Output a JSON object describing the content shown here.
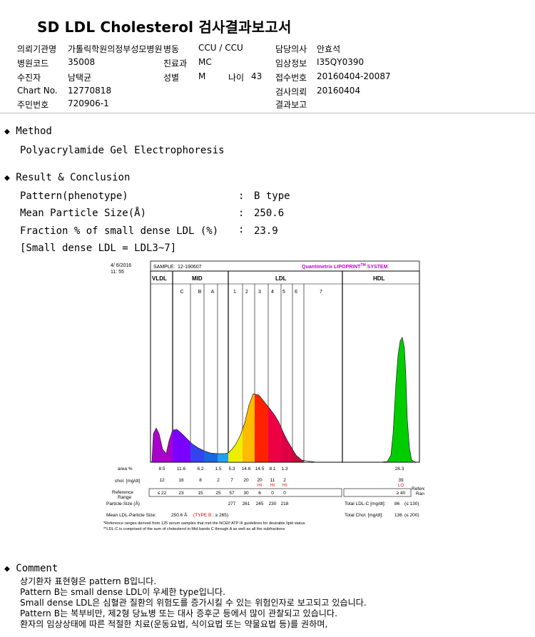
{
  "report_title": "SD LDL Cholesterol 검사결과보고서",
  "patient_info": {
    "institution_label": "의뢰기관명",
    "institution": "가톨릭학원의정부성모병원",
    "ward_label": "병동",
    "ward": "CCU / CCU",
    "doctor_label": "담당의사",
    "doctor": "안효석",
    "hospital_code_label": "병원코드",
    "hospital_code": "35008",
    "dept_label": "진료과",
    "dept": "MC",
    "clinical_label": "임상정보",
    "clinical": "I35QY0390",
    "patient_label": "수진자",
    "patient": "남택균",
    "sex_label": "성별",
    "sex": "M",
    "age_label": "나이",
    "age": "43",
    "receipt_label": "접수번호",
    "receipt": "20160404-20087",
    "chart_label": "Chart No.",
    "chart": "12770818",
    "request_date_label": "검사의뢰",
    "request_date": "20160404",
    "rrn_label": "주민번호",
    "rrn": "720906-1",
    "report_label": "결과보고",
    "report_date": ""
  },
  "method": {
    "heading": "Method",
    "text": "Polyacrylamide Gel Electrophoresis"
  },
  "result": {
    "heading": "Result & Conclusion",
    "rows": [
      {
        "label": "Pattern(phenotype)",
        "value": "B type"
      },
      {
        "label": "Mean Particle Size(Å)",
        "value": "250.6"
      },
      {
        "label": "Fraction % of small dense LDL (%)",
        "value": "23.9"
      }
    ],
    "note": "[Small dense LDL = LDL3~7]"
  },
  "lipoprint": {
    "date": "4/ 6/2016",
    "time": "11: 55",
    "sample_label": "SAMPLE:",
    "sample": "12-190607",
    "brand": "Quantimetrix LIPOPRINT",
    "brand_tm": "TM",
    "brand_suffix": " SYSTEM",
    "headers": {
      "vldl": "VLDL",
      "mid": "MID",
      "ldl": "LDL",
      "hdl": "HDL"
    },
    "subbands": [
      "C",
      "B",
      "A",
      "1",
      "2",
      "3",
      "4",
      "5",
      "6",
      "7"
    ],
    "row_labels": {
      "area": "area %",
      "chol": "chol. [mg/dl]",
      "ref": "Reference Range",
      "ps": "Particle-Size (Å)",
      "mean": "Mean LDL-Particle Size:"
    },
    "area": [
      "8.5",
      "11.6",
      "6.2",
      "1.5",
      "5.3",
      "14.6",
      "14.5",
      "8.1",
      "1.3"
    ],
    "hdl_area": "28.3",
    "chol": [
      "12",
      "16",
      "8",
      "2",
      "7",
      "20",
      "20",
      "11",
      "2"
    ],
    "chol_flags": [
      "",
      "",
      "",
      "",
      "",
      "",
      "HI",
      "HI",
      "HI"
    ],
    "hdl_chol": "39",
    "hdl_flag": "LO",
    "ref": [
      "≤ 22",
      "23",
      "15",
      "25",
      "57",
      "30",
      "6",
      "0",
      "0"
    ],
    "hdl_ref": "≥ 40",
    "ref_right": "Reference Range",
    "particle_sizes": [
      "277",
      "261",
      "245",
      "230",
      "218"
    ],
    "mean_size": "250.6 Å",
    "mean_type": "(TYPE B",
    "mean_cond": "; ≥ 265)",
    "ldl_c_label": "Total LDL-C [mg/dl]:",
    "ldl_c": "86",
    "ldl_c_ref": "(≤ 130)",
    "tchol_label": "Total Chol. [mg/dl]:",
    "tchol": "136",
    "tchol_ref": "(≤ 200)",
    "footnote1": "*Reference ranges derived from 125 serum samples that met the NCEP ATP III guidelines for desirable lipid status",
    "footnote2": "**LDL-C is comprised of the sum of cholesterol in Mid bands C through A as well as all the subfractions"
  },
  "comment": {
    "heading": "Comment",
    "lines": [
      "상기환자 표현형은 pattern B입니다.",
      "Pattern B는 small dense LDL이 우세한 type입니다.",
      "Small dense LDL은 심혈관 질환의 위험도를 증가시킬 수 있는 위험인자로 보고되고 있습니다.",
      "Pattern B는 복부비만, 제2형 당뇨병 또는 대사 증후군 등에서 많이 관찰되고 있습니다.",
      "환자의 임상상태에 따른 적절한 치료(운동요법, 식이요법 또는 약물요법 등)를 권하며,"
    ]
  },
  "colors": {
    "accent_magenta": "#cc00cc",
    "flag_red": "#dd0000",
    "hdl_green": "#00cc00"
  }
}
